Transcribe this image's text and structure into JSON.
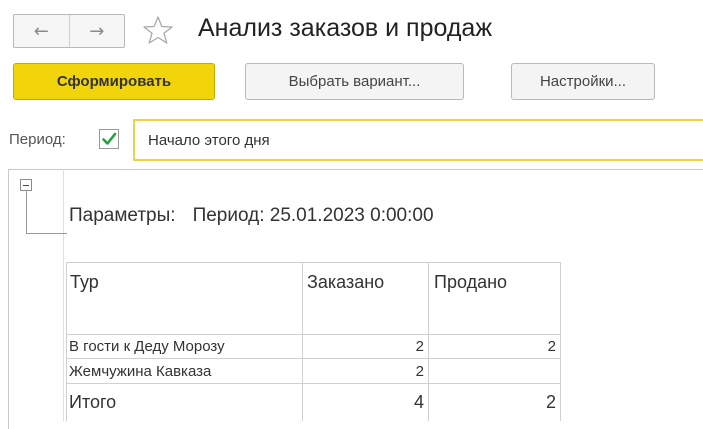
{
  "header": {
    "title": "Анализ заказов и продаж",
    "back_icon": "←",
    "forward_icon": "→"
  },
  "toolbar": {
    "generate_label": "Сформировать",
    "variant_label": "Выбрать вариант...",
    "settings_label": "Настройки..."
  },
  "period": {
    "label": "Период:",
    "checked": true,
    "value": "Начало этого дня"
  },
  "report": {
    "params_label": "Параметры:",
    "params_value": "Период: 25.01.2023 0:00:00",
    "columns": [
      "Тур",
      "Заказано",
      "Продано"
    ],
    "rows": [
      {
        "tour": "В гости к Деду Морозу",
        "ordered": "2",
        "sold": "2"
      },
      {
        "tour": "Жемчужина Кавказа",
        "ordered": "2",
        "sold": ""
      }
    ],
    "total": {
      "label": "Итого",
      "ordered": "4",
      "sold": "2"
    }
  },
  "colors": {
    "primary_button": "#f2d40b",
    "field_border": "#f1cf4a",
    "check": "#22a33a"
  }
}
